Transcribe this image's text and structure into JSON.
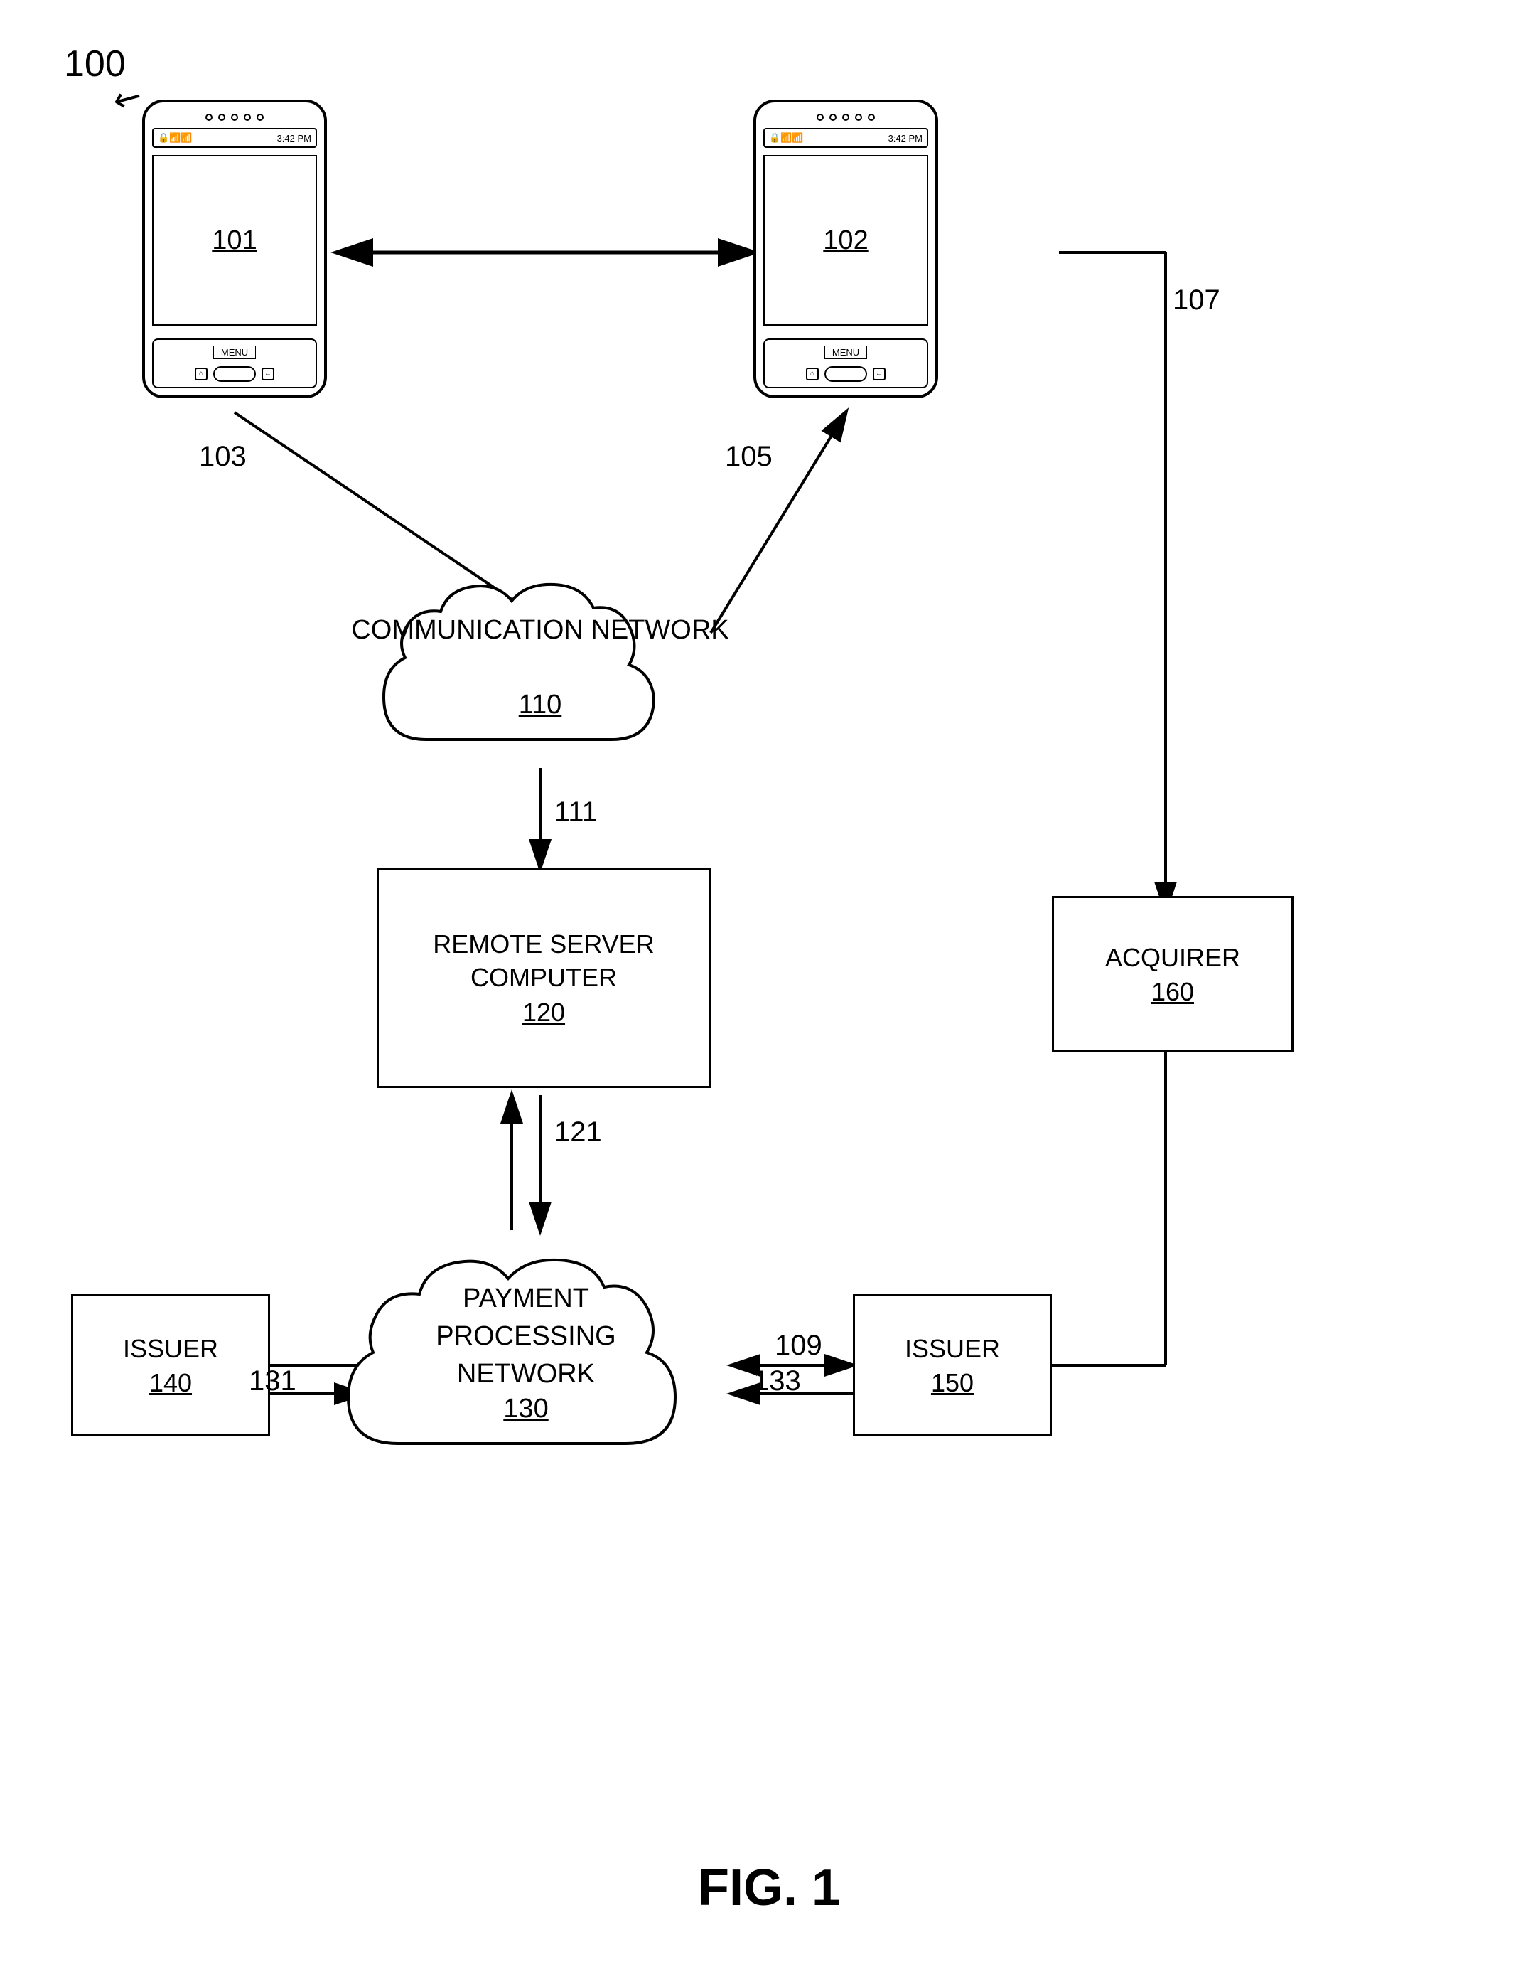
{
  "figure": {
    "label": "FIG. 1",
    "ref_100": "100"
  },
  "devices": {
    "phone_left": {
      "ref": "101",
      "status_text": "3:42 PM"
    },
    "phone_right": {
      "ref": "102",
      "status_text": "3:42 PM"
    }
  },
  "nodes": {
    "comm_network": {
      "label": "COMMUNICATION\nNETWORK",
      "ref": "110"
    },
    "remote_server": {
      "label": "REMOTE SERVER\nCOMPUTER",
      "ref": "120"
    },
    "payment_network": {
      "label": "PAYMENT\nPROCESSING\nNETWORK",
      "ref": "130"
    },
    "acquirer": {
      "label": "ACQUIRER",
      "ref": "160"
    },
    "issuer_140": {
      "label": "ISSUER",
      "ref": "140"
    },
    "issuer_150": {
      "label": "ISSUER",
      "ref": "150"
    }
  },
  "arrows": {
    "a103": "103",
    "a105": "105",
    "a107": "107",
    "a111": "111",
    "a121": "121",
    "a109": "109",
    "a131": "131",
    "a133": "133"
  }
}
